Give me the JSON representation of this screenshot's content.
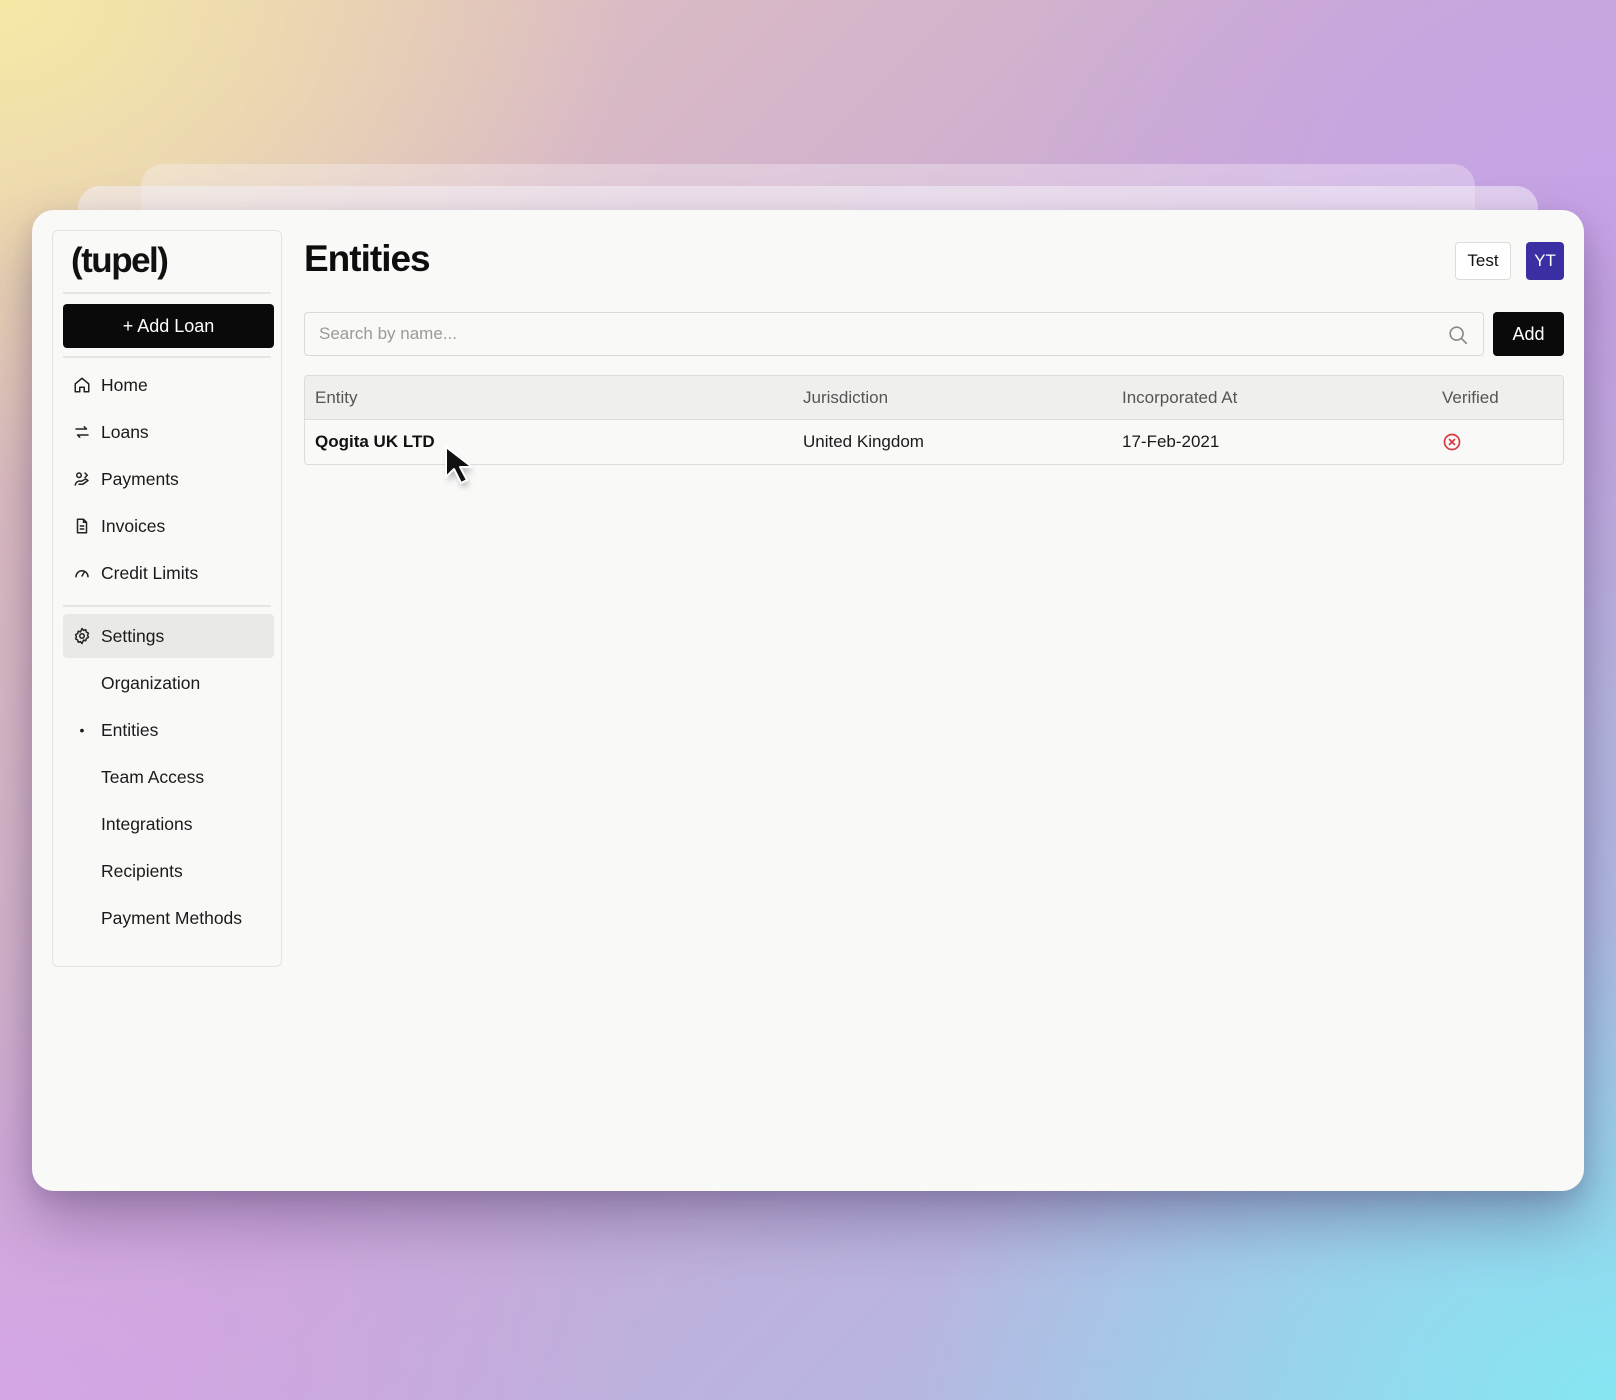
{
  "app": {
    "logo": "(tupel)"
  },
  "sidebar": {
    "add_loan_label": "+ Add Loan",
    "items": [
      {
        "label": "Home",
        "icon": "home-icon"
      },
      {
        "label": "Loans",
        "icon": "arrows-swap-icon"
      },
      {
        "label": "Payments",
        "icon": "payments-icon"
      },
      {
        "label": "Invoices",
        "icon": "document-icon"
      },
      {
        "label": "Credit Limits",
        "icon": "gauge-icon"
      }
    ],
    "settings": {
      "label": "Settings",
      "icon": "gear-icon"
    },
    "settings_items": [
      {
        "label": "Organization"
      },
      {
        "label": "Entities",
        "active": true,
        "marker": "•"
      },
      {
        "label": "Team Access"
      },
      {
        "label": "Integrations"
      },
      {
        "label": "Recipients"
      },
      {
        "label": "Payment Methods"
      }
    ]
  },
  "header": {
    "title": "Entities",
    "env_label": "Test",
    "avatar_initials": "YT",
    "avatar_color": "#3c2fa3"
  },
  "search": {
    "placeholder": "Search by name...",
    "value": ""
  },
  "toolbar": {
    "add_label": "Add"
  },
  "table": {
    "columns": [
      "Entity",
      "Jurisdiction",
      "Incorporated At",
      "Verified"
    ],
    "rows": [
      {
        "entity": "Qogita UK LTD",
        "jurisdiction": "United Kingdom",
        "incorporated_at": "17-Feb-2021",
        "verified": false,
        "verified_icon": "x-circle-icon",
        "verified_color": "#d9363e"
      }
    ]
  }
}
